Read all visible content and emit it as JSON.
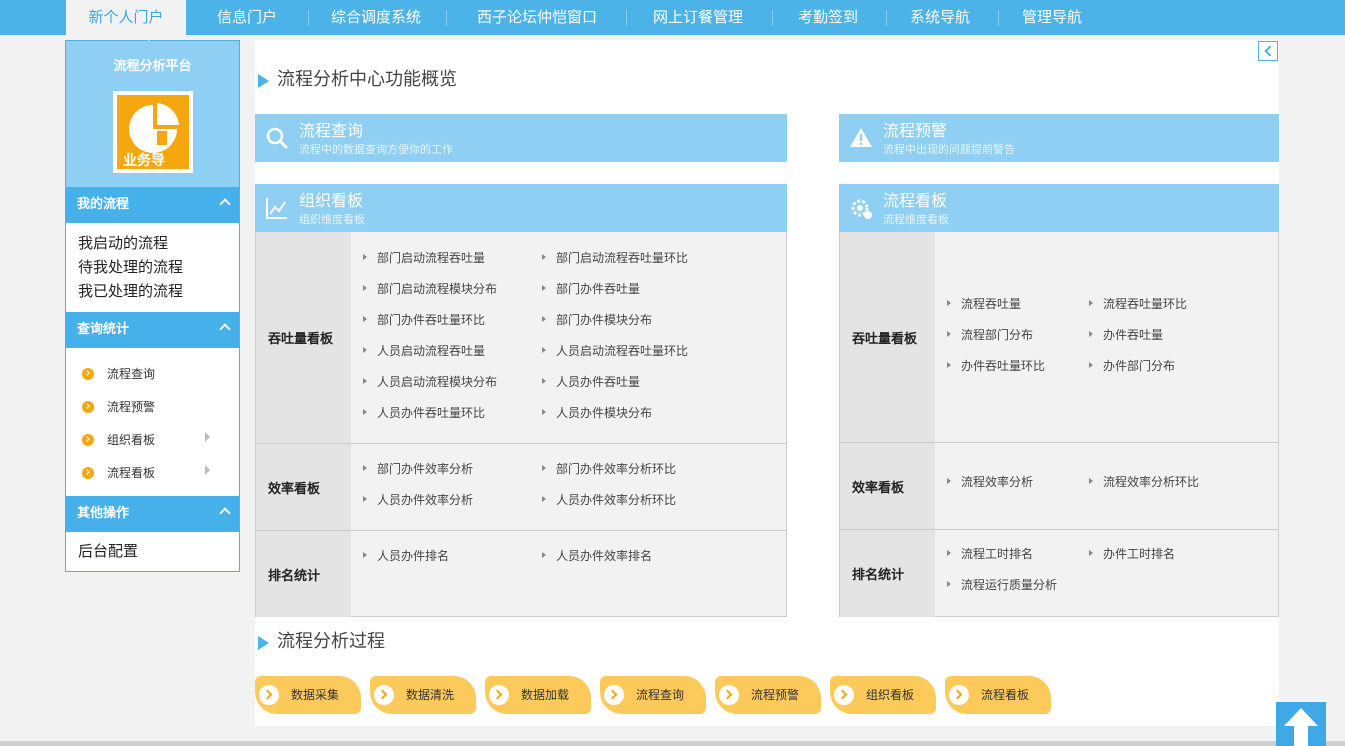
{
  "nav": {
    "items": [
      {
        "label": "新个人门户",
        "active": true
      },
      {
        "label": "信息门户"
      },
      {
        "label": "综合调度系统"
      },
      {
        "label": "西子论坛仲恺窗口"
      },
      {
        "label": "网上订餐管理"
      },
      {
        "label": "考勤签到"
      },
      {
        "label": "系统导航"
      },
      {
        "label": "管理导航"
      }
    ]
  },
  "sidebar": {
    "platform_title": "流程分析平台",
    "app_caption": "业务导",
    "my_flow": {
      "header": "我的流程",
      "items": [
        "我启动的流程",
        "待我处理的流程",
        "我已处理的流程"
      ]
    },
    "query": {
      "header": "查询统计",
      "items": [
        "流程查询",
        "流程预警",
        "组织看板",
        "流程看板"
      ]
    },
    "other": {
      "header": "其他操作",
      "items": [
        "后台配置"
      ]
    }
  },
  "main": {
    "overview_title": "流程分析中心功能概览",
    "process_title": "流程分析过程",
    "cards": {
      "query": {
        "title": "流程查询",
        "subtitle": "流程中的数据查询方便你的工作",
        "icon": "search-icon"
      },
      "warning": {
        "title": "流程预警",
        "subtitle": "流程中出现的问题提前警告",
        "icon": "warning-icon"
      },
      "org": {
        "title": "组织看板",
        "subtitle": "组织维度看板",
        "icon": "chart-icon"
      },
      "flow": {
        "title": "流程看板",
        "subtitle": "流程维度看板",
        "icon": "gear-icon"
      }
    },
    "org_board": {
      "throughput": {
        "label": "吞吐量看板",
        "links": [
          "部门启动流程吞吐量",
          "部门启动流程吞吐量环比",
          "部门启动流程模块分布",
          "部门办件吞吐量",
          "部门办件吞吐量环比",
          "部门办件模块分布",
          "人员启动流程吞吐量",
          "人员启动流程吞吐量环比",
          "人员启动流程模块分布",
          "人员办件吞吐量",
          "人员办件吞吐量环比",
          "人员办件模块分布"
        ]
      },
      "efficiency": {
        "label": "效率看板",
        "links": [
          "部门办件效率分析",
          "部门办件效率分析环比",
          "人员办件效率分析",
          "人员办件效率分析环比"
        ]
      },
      "ranking": {
        "label": "排名统计",
        "links": [
          "人员办件排名",
          "人员办件效率排名"
        ]
      }
    },
    "flow_board": {
      "throughput": {
        "label": "吞吐量看板",
        "links": [
          "流程吞吐量",
          "流程吞吐量环比",
          "流程部门分布",
          "办件吞吐量",
          "办件吞吐量环比",
          "办件部门分布"
        ]
      },
      "efficiency": {
        "label": "效率看板",
        "links": [
          "流程效率分析",
          "流程效率分析环比"
        ]
      },
      "ranking": {
        "label": "排名统计",
        "links": [
          "流程工时排名",
          "办件工时排名",
          "流程运行质量分析"
        ]
      }
    },
    "steps": [
      "数据采集",
      "数据清洗",
      "数据加载",
      "流程查询",
      "流程预警",
      "组织看板",
      "流程看板"
    ]
  },
  "colors": {
    "accent": "#4cb3e8",
    "card": "#8ecff3",
    "orange": "#f6a70f",
    "step": "#fcca5b"
  }
}
